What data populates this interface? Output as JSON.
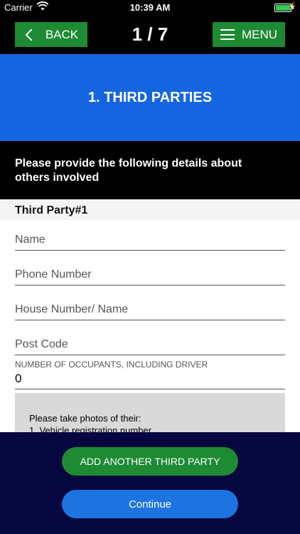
{
  "status_bar": {
    "carrier": "Carrier",
    "time": "10:39 AM",
    "wifi_icon": "wifi-icon",
    "battery_icon": "battery-icon"
  },
  "nav": {
    "back_label": "BACK",
    "back_icon": "chevron-left-icon",
    "step": "1 / 7",
    "menu_label": "MENU",
    "menu_icon": "hamburger-icon"
  },
  "banner": {
    "title": "1. THIRD PARTIES"
  },
  "instruction": {
    "text": "Please provide the following details about others involved"
  },
  "form": {
    "section_title": "Third Party#1",
    "name_placeholder": "Name",
    "phone_placeholder": "Phone Number",
    "house_placeholder": "House Number/ Name",
    "postcode_placeholder": "Post Code",
    "occupants_label": "NUMBER OF OCCUPANTS, INCLUDING DRIVER",
    "occupants_value": "0"
  },
  "photos": {
    "title": "Please take photos of their:",
    "item1": "1. Vehicle registration number"
  },
  "footer": {
    "add_label": "ADD ANOTHER THIRD PARTY",
    "continue_label": "Continue"
  },
  "colors": {
    "accent_green": "#1e8a34",
    "banner_blue": "#1565e0",
    "footer_navy": "#06073f",
    "continue_blue": "#1d74e0"
  }
}
